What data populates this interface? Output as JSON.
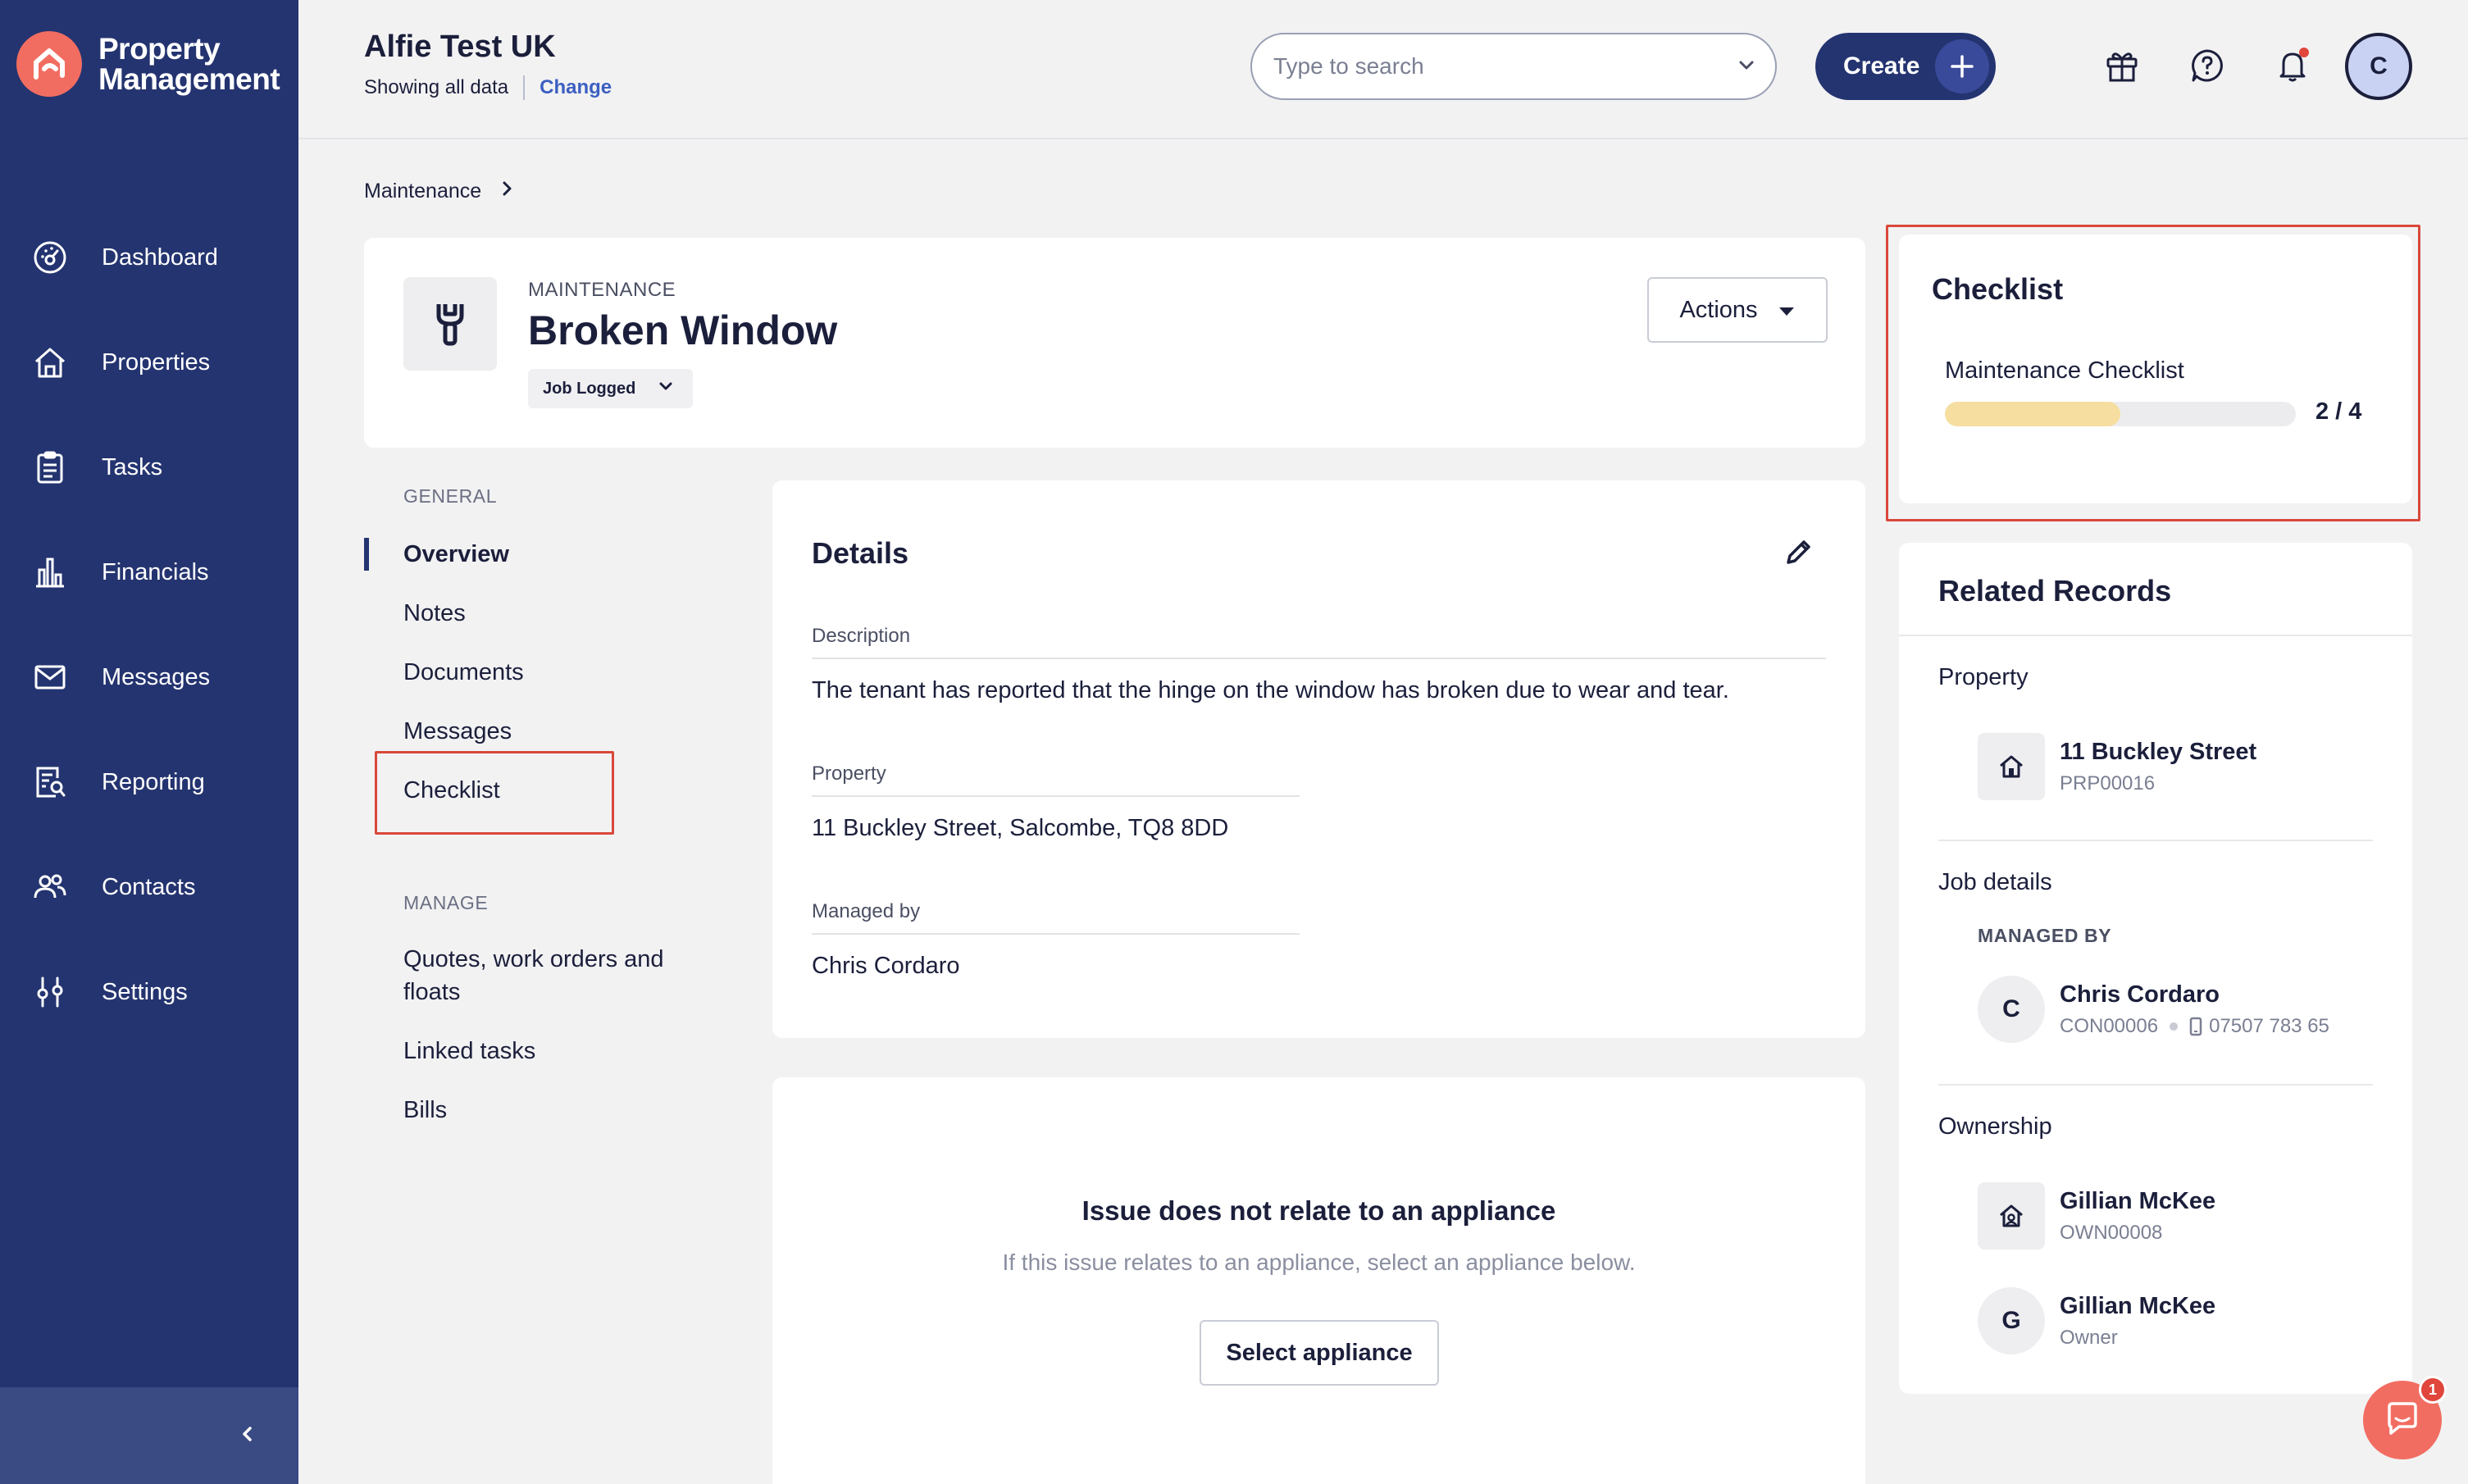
{
  "app": {
    "name_line1": "Property",
    "name_line2": "Management"
  },
  "sidebar": {
    "items": [
      {
        "label": "Dashboard",
        "icon": "dashboard-icon"
      },
      {
        "label": "Properties",
        "icon": "home-icon"
      },
      {
        "label": "Tasks",
        "icon": "clipboard-icon"
      },
      {
        "label": "Financials",
        "icon": "chart-bars-icon"
      },
      {
        "label": "Messages",
        "icon": "mail-icon"
      },
      {
        "label": "Reporting",
        "icon": "report-search-icon"
      },
      {
        "label": "Contacts",
        "icon": "people-icon"
      },
      {
        "label": "Settings",
        "icon": "sliders-icon"
      }
    ]
  },
  "header": {
    "account": "Alfie Test UK",
    "scope": "Showing all data",
    "change": "Change",
    "search_placeholder": "Type to search",
    "create": "Create",
    "avatar_initial": "C"
  },
  "breadcrumb": {
    "item": "Maintenance"
  },
  "record": {
    "eyebrow": "MAINTENANCE",
    "title": "Broken Window",
    "status": "Job Logged",
    "actions": "Actions"
  },
  "secnav": {
    "general_head": "GENERAL",
    "general": [
      "Overview",
      "Notes",
      "Documents",
      "Messages",
      "Checklist"
    ],
    "manage_head": "MANAGE",
    "manage": [
      "Quotes, work orders and floats",
      "Linked tasks",
      "Bills"
    ]
  },
  "details": {
    "title": "Details",
    "description_label": "Description",
    "description": "The tenant has reported that the hinge on the window has broken due to wear and tear.",
    "property_label": "Property",
    "property": "11 Buckley Street, Salcombe, TQ8 8DD",
    "managed_label": "Managed by",
    "managed": "Chris Cordaro"
  },
  "appliance": {
    "title": "Issue does not relate to an appliance",
    "subtitle": "If this issue relates to an appliance, select an appliance below.",
    "button": "Select appliance"
  },
  "checklist": {
    "title": "Checklist",
    "name": "Maintenance Checklist",
    "count": "2 / 4",
    "progress": 0.5,
    "fill_color": "#f6dea0"
  },
  "related": {
    "title": "Related Records",
    "property_head": "Property",
    "property_name": "11 Buckley Street",
    "property_ref": "PRP00016",
    "job_head": "Job details",
    "managed_by_head": "MANAGED BY",
    "manager_initial": "C",
    "manager_name": "Chris Cordaro",
    "manager_ref": "CON00006",
    "manager_phone": "07507 783 65",
    "ownership_head": "Ownership",
    "owner1_name": "Gillian McKee",
    "owner1_ref": "OWN00008",
    "owner2_initial": "G",
    "owner2_name": "Gillian McKee",
    "owner2_role": "Owner"
  },
  "chat": {
    "badge": "1"
  },
  "colors": {
    "sidebar": "#243470",
    "accent": "#f26d61",
    "highlight": "#d9483b",
    "link": "#3b5fc1"
  }
}
